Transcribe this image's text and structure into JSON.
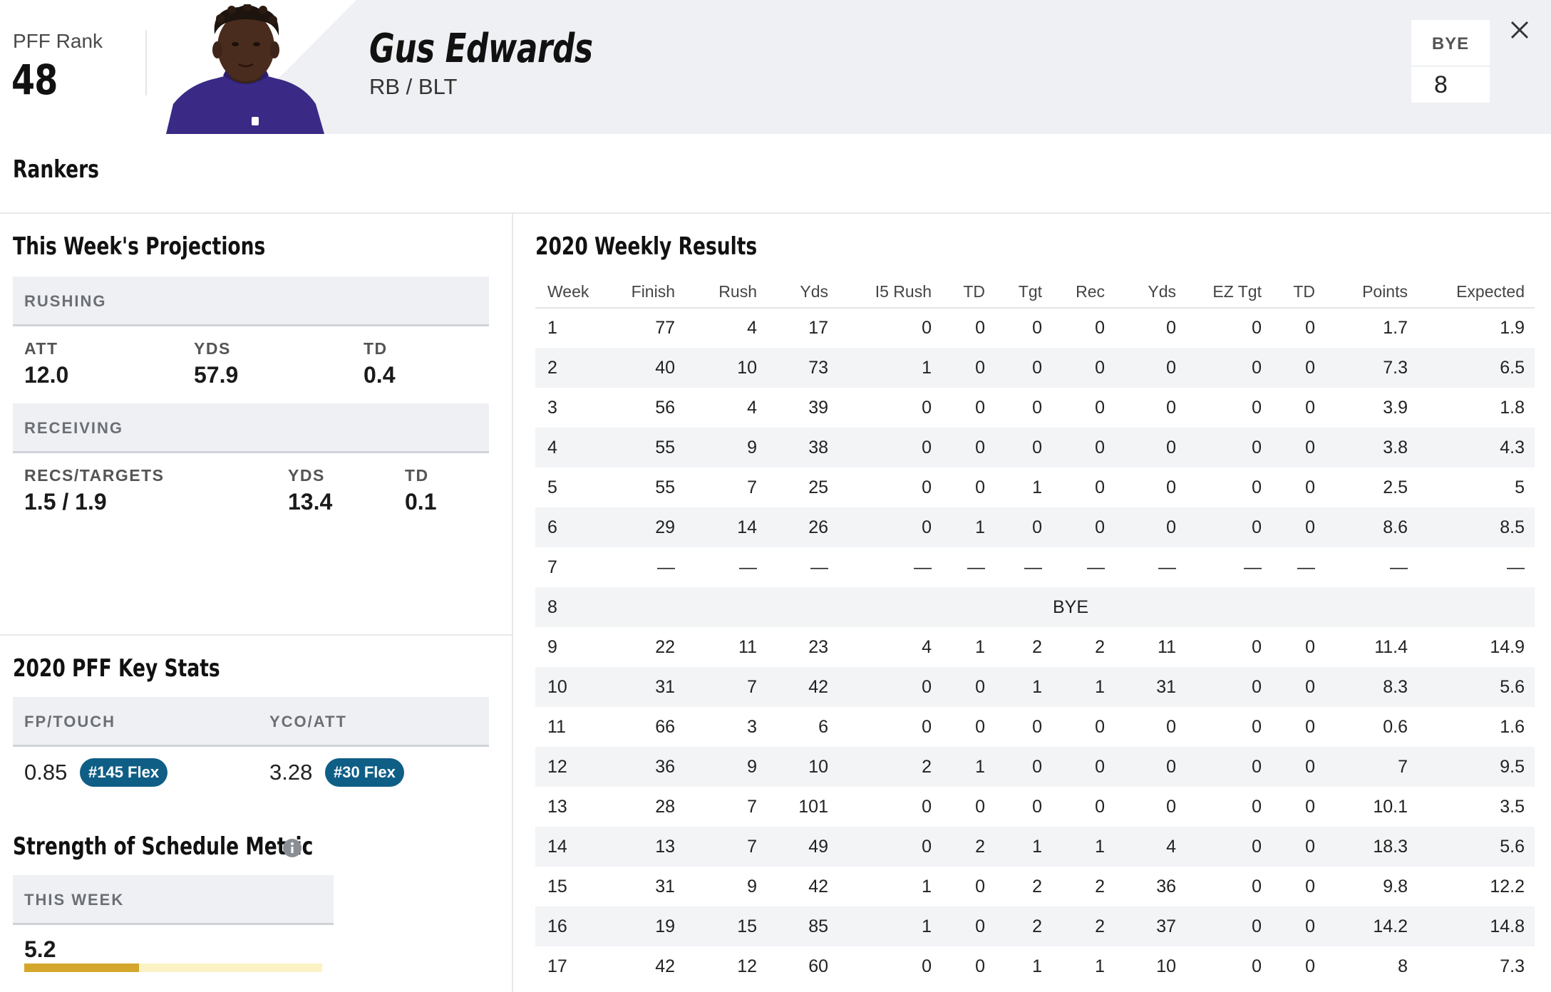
{
  "header": {
    "rank_label": "PFF Rank",
    "rank_value": "48",
    "player_name": "Gus Edwards",
    "position_team": "RB / BLT",
    "bye_label": "BYE",
    "bye_value": "8",
    "close_icon": "close-icon",
    "photo": "player-headshot"
  },
  "rankers": {
    "title": "Rankers"
  },
  "projections": {
    "title": "This Week's Projections",
    "rushing": {
      "label": "RUSHING",
      "stats": [
        {
          "label": "ATT",
          "value": "12.0"
        },
        {
          "label": "YDS",
          "value": "57.9"
        },
        {
          "label": "TD",
          "value": "0.4"
        }
      ]
    },
    "receiving": {
      "label": "RECEIVING",
      "stats": [
        {
          "label": "RECS/TARGETS",
          "value": "1.5 / 1.9"
        },
        {
          "label": "YDS",
          "value": "13.4"
        },
        {
          "label": "TD",
          "value": "0.1"
        }
      ]
    }
  },
  "key_stats": {
    "title": "2020 PFF Key Stats",
    "stats": [
      {
        "label": "FP/TOUCH",
        "value": "0.85",
        "badge": "#145 Flex"
      },
      {
        "label": "YCO/ATT",
        "value": "3.28",
        "badge": "#30 Flex"
      }
    ],
    "badge_color": "#0f5e86"
  },
  "sos": {
    "title": "Strength of Schedule Metric",
    "info_icon": "info-icon",
    "band_label": "THIS WEEK",
    "value": "5.2",
    "bar_fraction": 0.385,
    "bar_color": "#d4a72c",
    "track_color": "#fbf3c6"
  },
  "weekly": {
    "title": "2020 Weekly Results",
    "columns": [
      "Week",
      "Finish",
      "Rush",
      "Yds",
      "I5 Rush",
      "TD",
      "Tgt",
      "Rec",
      "Yds",
      "EZ Tgt",
      "TD",
      "Points",
      "Expected"
    ],
    "rows": [
      [
        "1",
        "77",
        "4",
        "17",
        "0",
        "0",
        "0",
        "0",
        "0",
        "0",
        "0",
        "1.7",
        "1.9"
      ],
      [
        "2",
        "40",
        "10",
        "73",
        "1",
        "0",
        "0",
        "0",
        "0",
        "0",
        "0",
        "7.3",
        "6.5"
      ],
      [
        "3",
        "56",
        "4",
        "39",
        "0",
        "0",
        "0",
        "0",
        "0",
        "0",
        "0",
        "3.9",
        "1.8"
      ],
      [
        "4",
        "55",
        "9",
        "38",
        "0",
        "0",
        "0",
        "0",
        "0",
        "0",
        "0",
        "3.8",
        "4.3"
      ],
      [
        "5",
        "55",
        "7",
        "25",
        "0",
        "0",
        "1",
        "0",
        "0",
        "0",
        "0",
        "2.5",
        "5"
      ],
      [
        "6",
        "29",
        "14",
        "26",
        "0",
        "1",
        "0",
        "0",
        "0",
        "0",
        "0",
        "8.6",
        "8.5"
      ],
      [
        "7",
        "—",
        "—",
        "—",
        "—",
        "—",
        "—",
        "—",
        "—",
        "—",
        "—",
        "—",
        "—"
      ],
      [
        "8",
        "BYE"
      ],
      [
        "9",
        "22",
        "11",
        "23",
        "4",
        "1",
        "2",
        "2",
        "11",
        "0",
        "0",
        "11.4",
        "14.9"
      ],
      [
        "10",
        "31",
        "7",
        "42",
        "0",
        "0",
        "1",
        "1",
        "31",
        "0",
        "0",
        "8.3",
        "5.6"
      ],
      [
        "11",
        "66",
        "3",
        "6",
        "0",
        "0",
        "0",
        "0",
        "0",
        "0",
        "0",
        "0.6",
        "1.6"
      ],
      [
        "12",
        "36",
        "9",
        "10",
        "2",
        "1",
        "0",
        "0",
        "0",
        "0",
        "0",
        "7",
        "9.5"
      ],
      [
        "13",
        "28",
        "7",
        "101",
        "0",
        "0",
        "0",
        "0",
        "0",
        "0",
        "0",
        "10.1",
        "3.5"
      ],
      [
        "14",
        "13",
        "7",
        "49",
        "0",
        "2",
        "1",
        "1",
        "4",
        "0",
        "0",
        "18.3",
        "5.6"
      ],
      [
        "15",
        "31",
        "9",
        "42",
        "1",
        "0",
        "2",
        "2",
        "36",
        "0",
        "0",
        "9.8",
        "12.2"
      ],
      [
        "16",
        "19",
        "15",
        "85",
        "1",
        "0",
        "2",
        "2",
        "37",
        "0",
        "0",
        "14.2",
        "14.8"
      ],
      [
        "17",
        "42",
        "12",
        "60",
        "0",
        "0",
        "1",
        "1",
        "10",
        "0",
        "0",
        "8",
        "7.3"
      ]
    ]
  }
}
